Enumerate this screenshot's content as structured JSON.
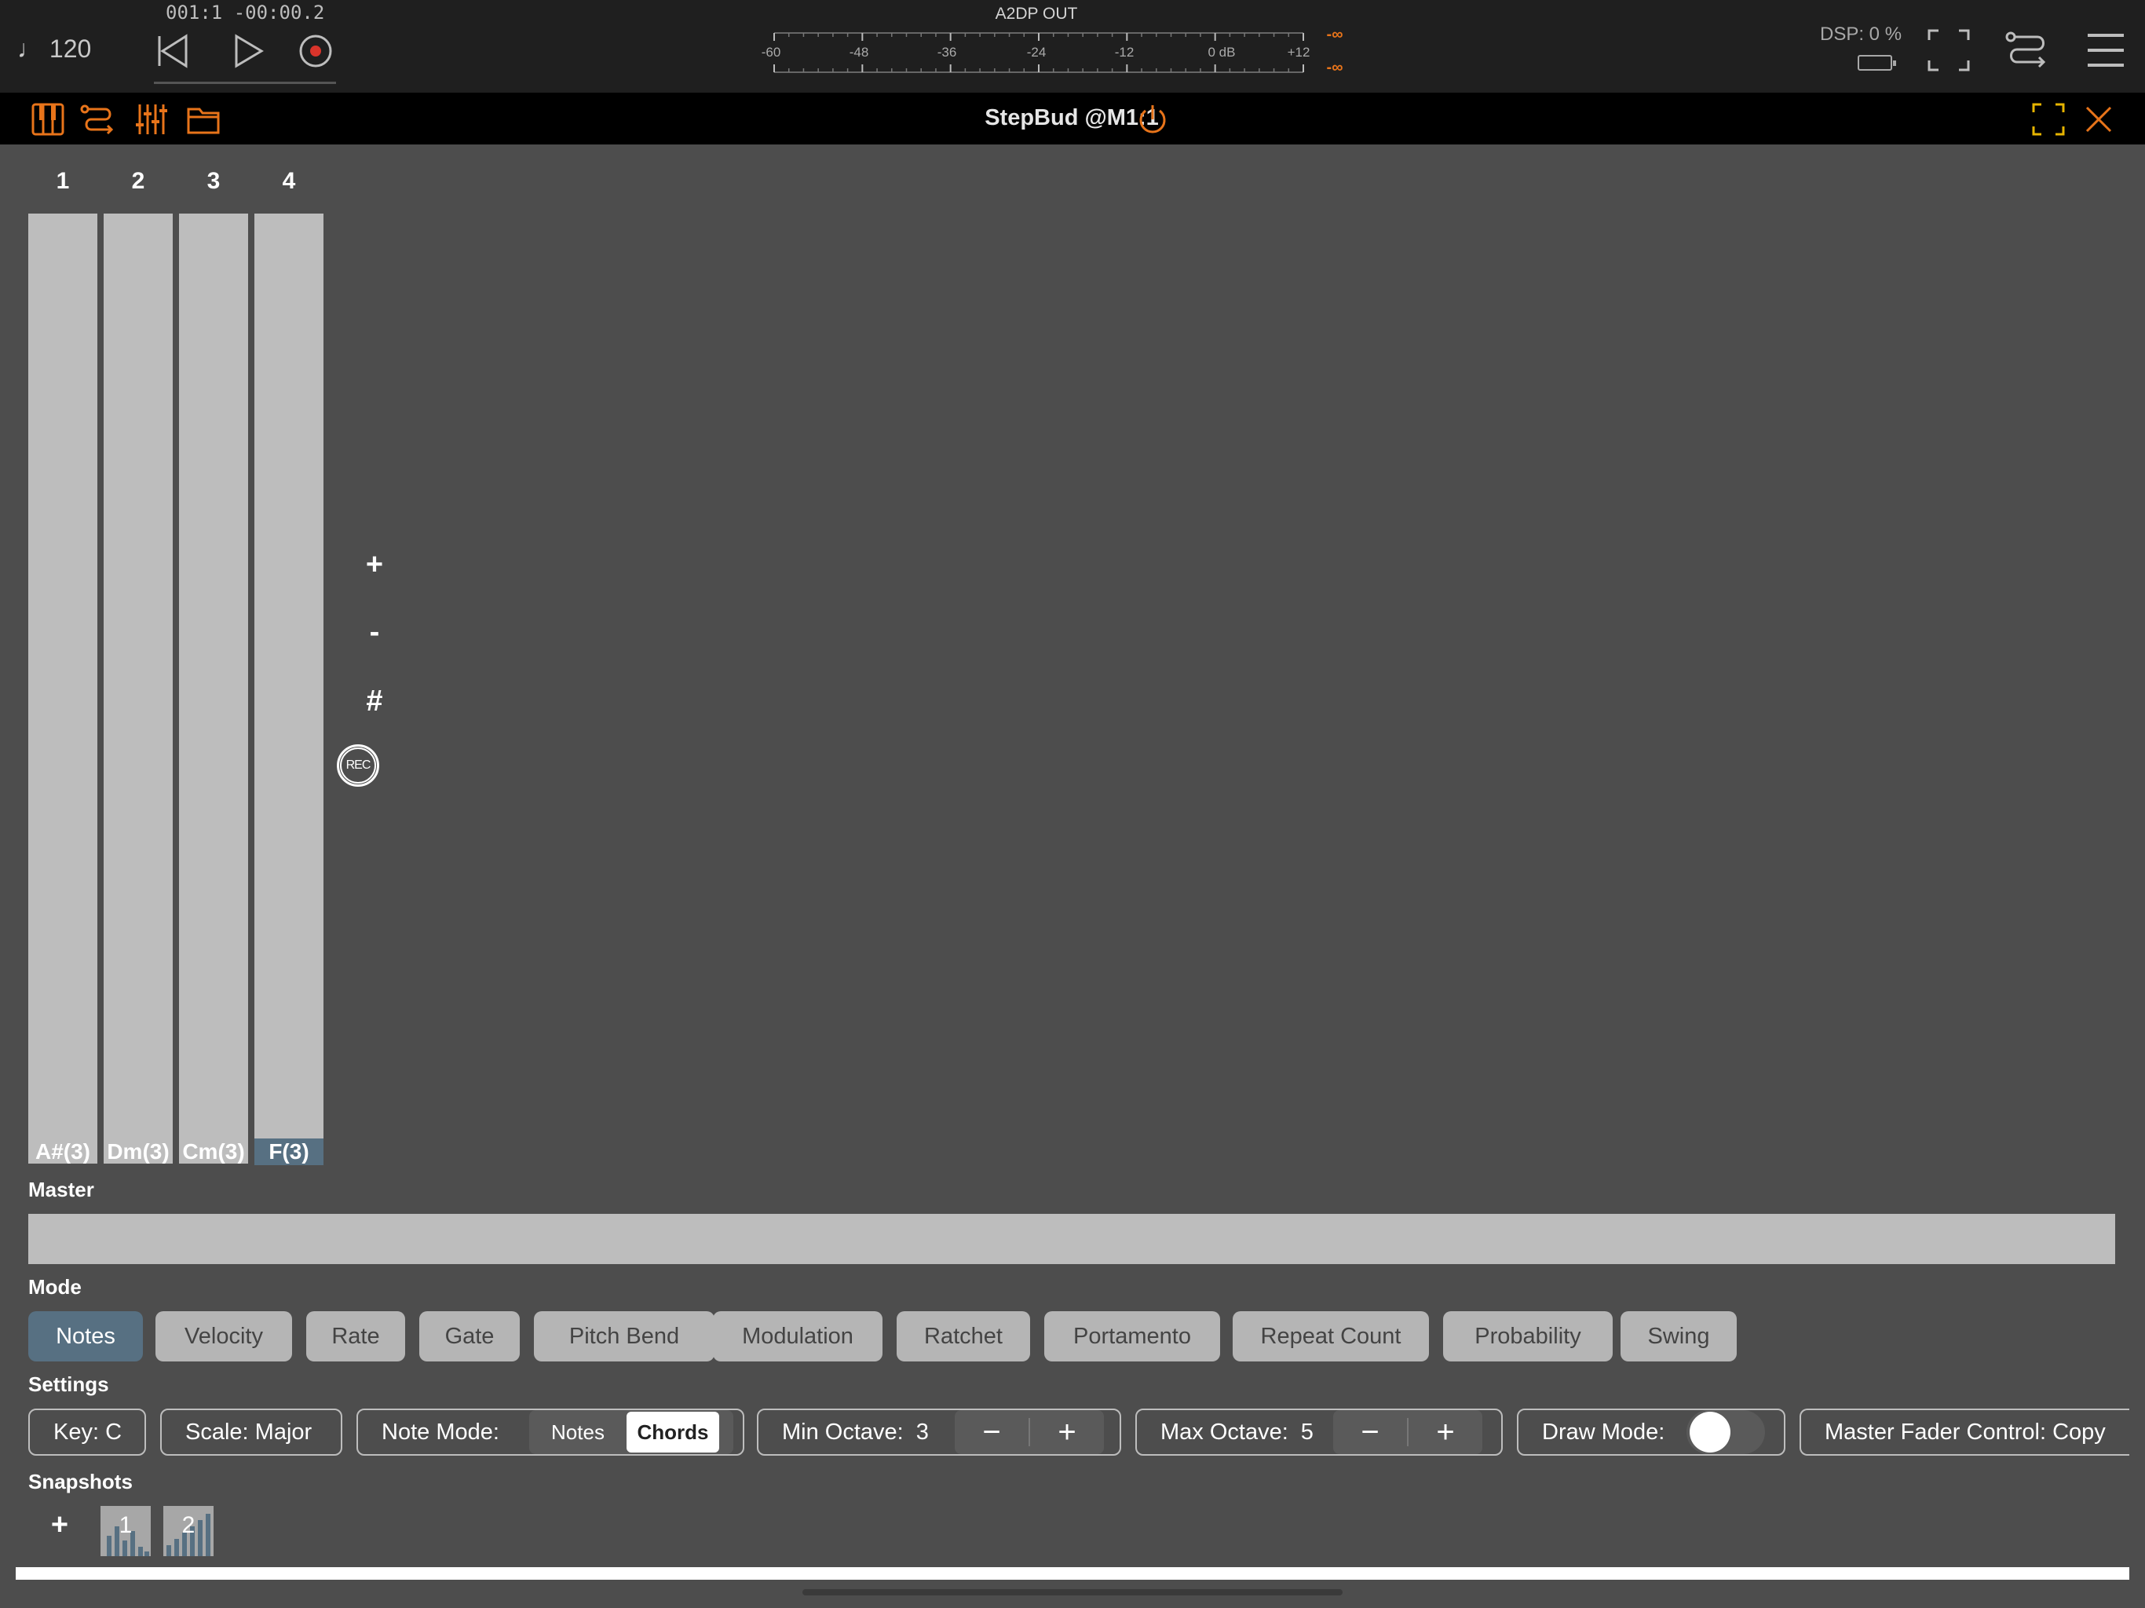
{
  "transport": {
    "tempo": "♩ 120",
    "position": "001:1 -00:00.2"
  },
  "meter": {
    "title": "A2DP OUT",
    "scale_labels": [
      "-60",
      "-48",
      "-36",
      "-24",
      "-12",
      "0 dB",
      "+12"
    ],
    "peak_left": "-∞",
    "peak_right": "-∞"
  },
  "status": {
    "dsp": "DSP:  0 %"
  },
  "plugin": {
    "title": "StepBud @M1:1"
  },
  "steps": [
    {
      "number": "1",
      "label": "A#(3)",
      "active": false
    },
    {
      "number": "2",
      "label": "Dm(3)",
      "active": false
    },
    {
      "number": "3",
      "label": "Cm(3)",
      "active": false
    },
    {
      "number": "4",
      "label": "F(3)",
      "active": true
    }
  ],
  "side_controls": {
    "add": "+",
    "remove": "-",
    "sharp": "#",
    "rec": "REC"
  },
  "master": {
    "label": "Master"
  },
  "mode": {
    "label": "Mode",
    "options": [
      "Notes",
      "Velocity",
      "Rate",
      "Gate",
      "Pitch Bend",
      "Modulation",
      "Ratchet",
      "Portamento",
      "Repeat Count",
      "Probability",
      "Swing"
    ],
    "selected": "Notes"
  },
  "settings": {
    "label": "Settings",
    "key": "Key: C",
    "scale": "Scale: Major",
    "note_mode_label": "Note Mode:",
    "note_mode_options": [
      "Notes",
      "Chords"
    ],
    "note_mode_selected": "Chords",
    "min_octave_label": "Min Octave:",
    "min_octave_value": "3",
    "max_octave_label": "Max Octave:",
    "max_octave_value": "5",
    "draw_mode_label": "Draw Mode:",
    "draw_mode_on": false,
    "master_fader_control": "Master Fader Control: Copy",
    "minus": "−",
    "plus": "+"
  },
  "snapshots": {
    "label": "Snapshots",
    "add": "+",
    "items": [
      "1",
      "2"
    ]
  },
  "colors": {
    "accent_orange": "#e8741a",
    "fullscreen_yellow": "#e6b400",
    "active_blue_gray": "#577082",
    "bar_gray": "#bdbdbd",
    "record_red": "#d9342b"
  }
}
